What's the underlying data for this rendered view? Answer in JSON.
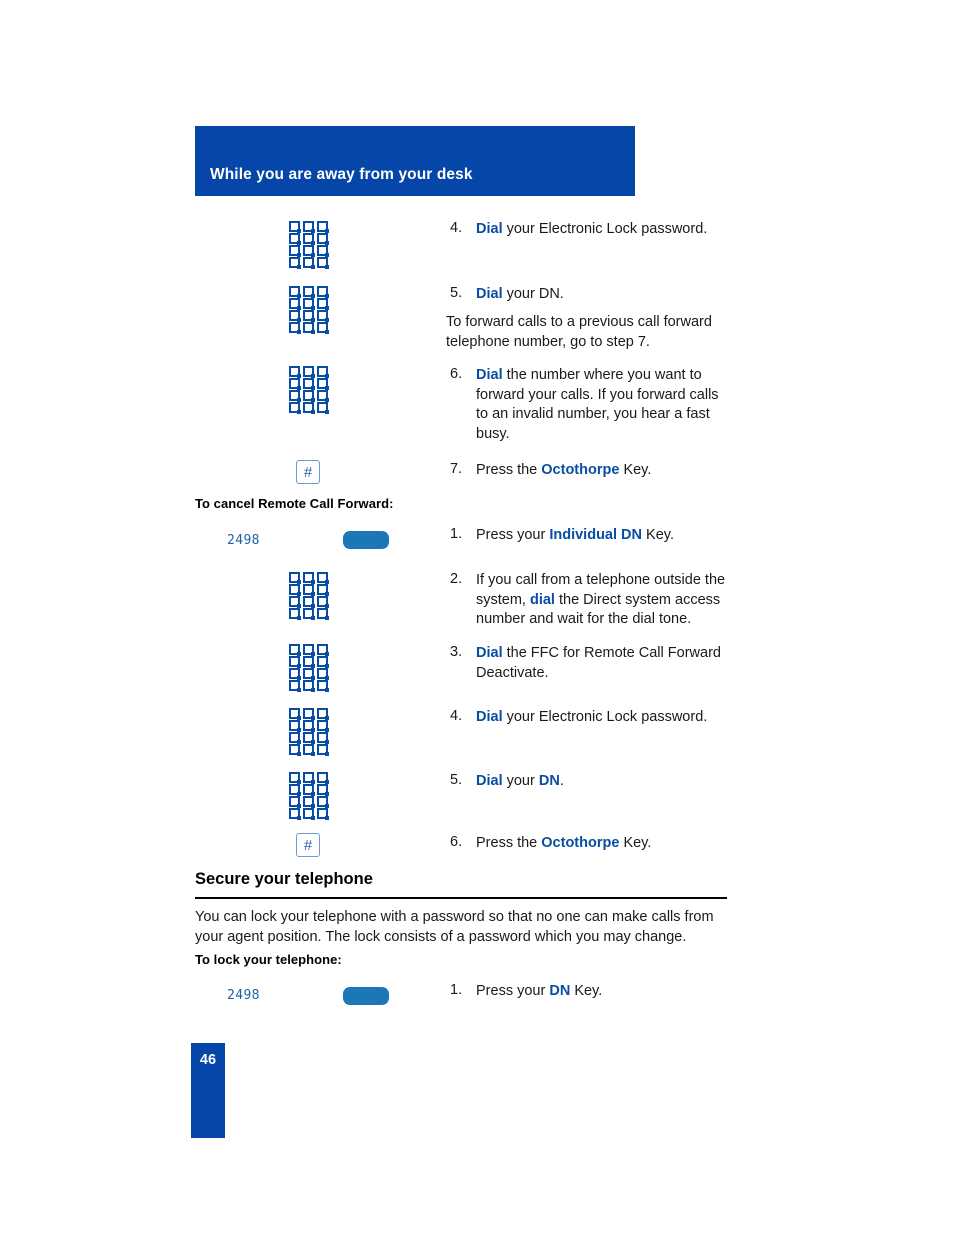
{
  "page": {
    "number": "46",
    "header_title": "While you are away from your desk"
  },
  "icons": {
    "keypad": "keypad-icon",
    "octothorpe_glyph": "#",
    "dn_key": "dn-key-button",
    "dn_key_label": "2498"
  },
  "colors": {
    "banner_blue": "#0546A8",
    "keyword_blue": "#0A4DA5",
    "dn_key_blue": "#1C77B9",
    "octothorpe_border": "#6D9BD1",
    "dn_label_blue": "#1F62A8"
  },
  "remote_call_forward_continued": {
    "steps": [
      {
        "number": "4.",
        "icon": "keypad",
        "parts": [
          {
            "text": "Dial",
            "style": "keyword"
          },
          {
            "text": " your Electronic Lock password.",
            "style": "normal"
          }
        ]
      },
      {
        "number": "5.",
        "icon": "keypad",
        "parts": [
          {
            "text": "Dial",
            "style": "keyword"
          },
          {
            "text": " your DN.",
            "style": "normal"
          }
        ],
        "note": "To forward calls to a previous call forward telephone number, go to step 7."
      },
      {
        "number": "6.",
        "icon": "keypad",
        "parts": [
          {
            "text": "Dial",
            "style": "keyword"
          },
          {
            "text": " the number where you want to forward your calls. If you forward calls to an invalid number, you hear a fast busy.",
            "style": "normal"
          }
        ]
      },
      {
        "number": "7.",
        "icon": "octothorpe",
        "parts": [
          {
            "text": "Press the ",
            "style": "normal"
          },
          {
            "text": "Octothorpe",
            "style": "keyword"
          },
          {
            "text": " Key.",
            "style": "normal"
          }
        ]
      }
    ]
  },
  "cancel_remote_call_forward": {
    "heading": "To cancel Remote Call Forward:",
    "steps": [
      {
        "number": "1.",
        "icon": "dn-key",
        "icon_label": "2498",
        "parts": [
          {
            "text": "Press your ",
            "style": "normal"
          },
          {
            "text": "Individual DN",
            "style": "keyword"
          },
          {
            "text": " Key.",
            "style": "normal"
          }
        ]
      },
      {
        "number": "2.",
        "icon": "keypad",
        "parts": [
          {
            "text": "If you call from a telephone outside the system, ",
            "style": "normal"
          },
          {
            "text": "dial",
            "style": "keyword"
          },
          {
            "text": " the Direct system access number and wait for the dial tone.",
            "style": "normal"
          }
        ]
      },
      {
        "number": "3.",
        "icon": "keypad",
        "parts": [
          {
            "text": "Dial",
            "style": "keyword"
          },
          {
            "text": " the FFC for Remote Call Forward Deactivate.",
            "style": "normal"
          }
        ]
      },
      {
        "number": "4.",
        "icon": "keypad",
        "parts": [
          {
            "text": "Dial",
            "style": "keyword"
          },
          {
            "text": " your Electronic Lock password.",
            "style": "normal"
          }
        ]
      },
      {
        "number": "5.",
        "icon": "keypad",
        "parts": [
          {
            "text": "Dial",
            "style": "keyword"
          },
          {
            "text": " your ",
            "style": "normal"
          },
          {
            "text": "DN",
            "style": "keyword"
          },
          {
            "text": ".",
            "style": "normal"
          }
        ]
      },
      {
        "number": "6.",
        "icon": "octothorpe",
        "parts": [
          {
            "text": "Press the ",
            "style": "normal"
          },
          {
            "text": "Octothorpe",
            "style": "keyword"
          },
          {
            "text": " Key.",
            "style": "normal"
          }
        ]
      }
    ]
  },
  "secure_your_telephone": {
    "heading": "Secure your telephone",
    "body": "You can lock your telephone with a password so that no one can make calls from your agent position. The lock consists of a password which you may change.",
    "sub_heading": "To lock your telephone:",
    "steps": [
      {
        "number": "1.",
        "icon": "dn-key",
        "icon_label": "2498",
        "parts": [
          {
            "text": "Press your ",
            "style": "normal"
          },
          {
            "text": "DN",
            "style": "keyword"
          },
          {
            "text": " Key.",
            "style": "normal"
          }
        ]
      }
    ]
  }
}
